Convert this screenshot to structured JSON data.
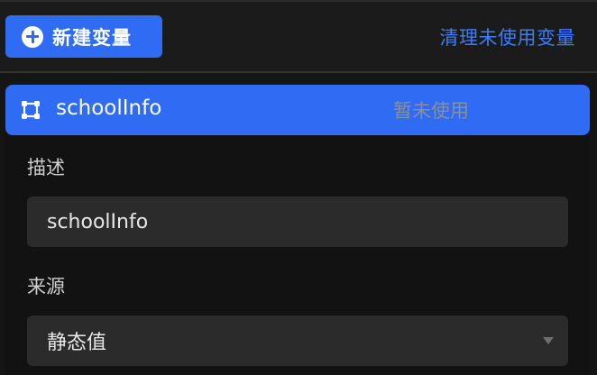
{
  "toolbar": {
    "new_variable_label": "新建变量",
    "cleanup_label": "清理未使用变量"
  },
  "variable": {
    "name": "schoolInfo",
    "status": "暂未使用",
    "description_label": "描述",
    "description_value": "schoolInfo",
    "source_label": "来源",
    "source_value": "静态值"
  },
  "colors": {
    "accent": "#2f6cf3",
    "link": "#3f7cf6",
    "background": "#151515",
    "field_bg": "#2b2b2b"
  },
  "icons": {
    "new_button": "plus-circle-icon",
    "variable": "node-graph-icon",
    "select": "caret-down-icon"
  }
}
